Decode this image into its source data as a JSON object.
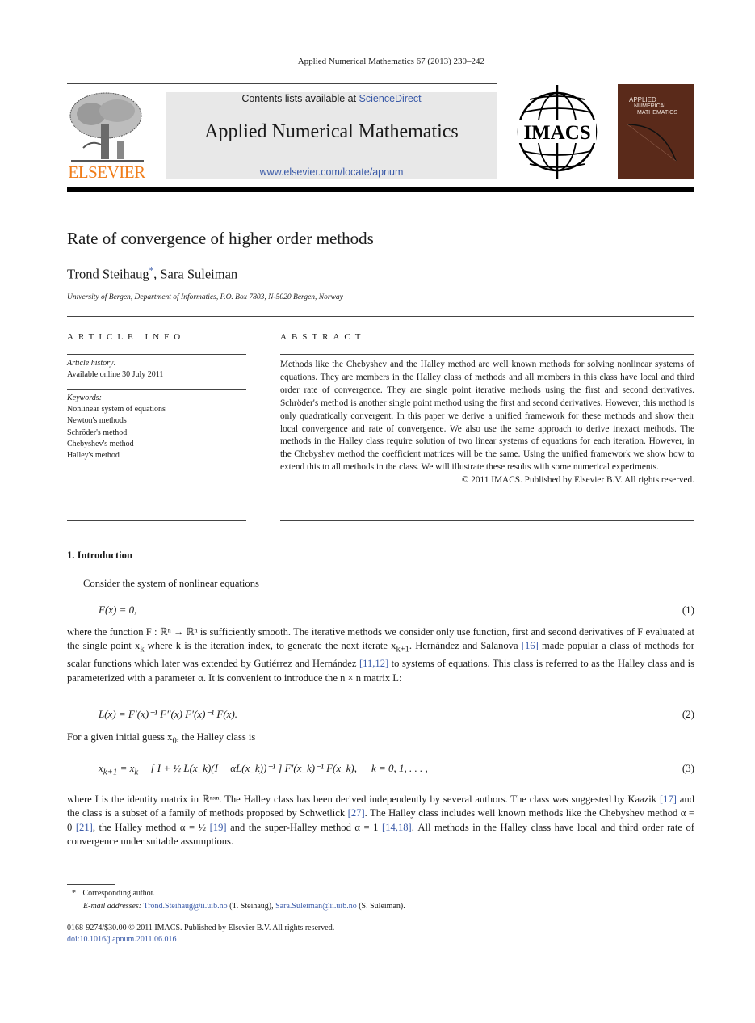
{
  "running_head": "Applied Numerical Mathematics 67 (2013) 230–242",
  "banner": {
    "contents_prefix": "Contents lists available at ",
    "contents_link": "ScienceDirect",
    "journal_title": "Applied Numerical Mathematics",
    "url": "www.elsevier.com/locate/apnum"
  },
  "logos": {
    "publisher": "ELSEVIER",
    "society": "IMACS",
    "cover_title": [
      "Applied",
      "Numerical",
      "Mathematics"
    ]
  },
  "colors": {
    "link": "#3a5aa8",
    "elsevier_orange": "#f07d1a",
    "banner_bg": "#e8e8e8",
    "cover_bg": "#5a2a1a"
  },
  "article": {
    "title": "Rate of convergence of higher order methods",
    "authors": [
      {
        "name": "Trond Steihaug",
        "mark": "*"
      },
      {
        "name": "Sara Suleiman",
        "mark": ""
      }
    ],
    "author_separator": ", ",
    "affiliation": "University of Bergen, Department of Informatics, P.O. Box 7803, N-5020 Bergen, Norway"
  },
  "article_info": {
    "heading": "ARTICLE INFO",
    "history_label": "Article history:",
    "history_value": "Available online 30 July 2011",
    "keywords_label": "Keywords:",
    "keywords": [
      "Nonlinear system of equations",
      "Newton's methods",
      "Schröder's method",
      "Chebyshev's method",
      "Halley's method"
    ]
  },
  "abstract": {
    "heading": "ABSTRACT",
    "text": "Methods like the Chebyshev and the Halley method are well known methods for solving nonlinear systems of equations. They are members in the Halley class of methods and all members in this class have local and third order rate of convergence. They are single point iterative methods using the first and second derivatives. Schröder's method is another single point method using the first and second derivatives. However, this method is only quadratically convergent. In this paper we derive a unified framework for these methods and show their local convergence and rate of convergence. We also use the same approach to derive inexact methods. The methods in the Halley class require solution of two linear systems of equations for each iteration. However, in the Chebyshev method the coefficient matrices will be the same. Using the unified framework we show how to extend this to all methods in the class. We will illustrate these results with some numerical experiments.",
    "copyright": "© 2011 IMACS. Published by Elsevier B.V. All rights reserved."
  },
  "section1": {
    "heading": "1. Introduction",
    "p1": "Consider the system of nonlinear equations",
    "eq1": "F(x) = 0,",
    "eq1_num": "(1)",
    "p2_parts": {
      "a": "where the function F : ℝⁿ → ℝⁿ is sufficiently smooth. The iterative methods we consider only use function, first and second derivatives of F evaluated at the single point x",
      "a_sub": "k",
      "b": " where k is the iteration index, to generate the next iterate x",
      "b_sub": "k+1",
      "c": ". Hernández and Salanova ",
      "ref1": "[16]",
      "d": " made popular a class of methods for scalar functions which later was extended by Gutiérrez and Hernández ",
      "ref2": "[11,12]",
      "e": " to systems of equations. This class is referred to as the Halley class and is parameterized with a parameter α. It is convenient to introduce the n × n matrix L:"
    },
    "eq2": "L(x) = F′(x)⁻¹ F″(x) F′(x)⁻¹ F(x).",
    "eq2_num": "(2)",
    "p3_prefix": "For a given initial guess x",
    "p3_sub": "0",
    "p3_suffix": ", the Halley class is",
    "eq3_left": "x",
    "eq3_left_sub": "k+1",
    "eq3_mid": " = x",
    "eq3_mid_sub": "k",
    "eq3_bracket": " − [ I + ½ L(x_k)(I − αL(x_k))⁻¹ ] F′(x_k)⁻¹ F(x_k),",
    "eq3_k": "k = 0, 1, . . . ,",
    "eq3_num": "(3)",
    "p4_parts": {
      "a": "where I is the identity matrix in ℝⁿˣⁿ. The Halley class has been derived independently by several authors. The class was suggested by Kaazik ",
      "ref1": "[17]",
      "b": " and the class is a subset of a family of methods proposed by Schwetlick ",
      "ref2": "[27]",
      "c": ". The Halley class includes well known methods like the Chebyshev method α = 0 ",
      "ref3": "[21]",
      "d": ", the Halley method α = ½ ",
      "ref4": "[19]",
      "e": " and the super-Halley method α = 1 ",
      "ref5": "[14,18]",
      "f": ". All methods in the Halley class have local and third order rate of convergence under suitable assumptions."
    }
  },
  "footnotes": {
    "mark": "*",
    "corresponding": "Corresponding author.",
    "email_label": "E-mail addresses:",
    "email1": "Trond.Steihaug@ii.uib.no",
    "email1_who": " (T. Steihaug), ",
    "email2": "Sara.Suleiman@ii.uib.no",
    "email2_who": " (S. Suleiman).",
    "issn_line": "0168-9274/$30.00 © 2011 IMACS. Published by Elsevier B.V. All rights reserved.",
    "doi": "doi:10.1016/j.apnum.2011.06.016"
  }
}
